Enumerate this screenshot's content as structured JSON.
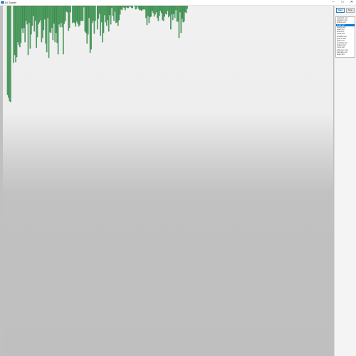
{
  "window": {
    "title": "ID Sorter",
    "minimize_glyph": "–",
    "maximize_glyph": "□",
    "close_glyph": "✕"
  },
  "side_panel": {
    "left_button_label": "Start",
    "right_button_label": "Stop",
    "list_items": [
      "selection sort",
      "insertion sort",
      "bubble sort",
      "quick sort",
      "merge sort",
      "heap sort",
      "shell sort",
      "comb sort",
      "cocktail sort",
      "gnome sort",
      "radix sort",
      "counting sort",
      "bucket sort",
      "cycle sort",
      "odd-even sort",
      "pancake sort",
      "bogo sort"
    ],
    "selected_index": 3
  },
  "chart_data": {
    "type": "bar",
    "orientation": "downward",
    "bar_color": "#5cb56e",
    "values": [
      30,
      26,
      21,
      20,
      217,
      227,
      75,
      86,
      76,
      83,
      104,
      100,
      97,
      103,
      123,
      117,
      124,
      104,
      134,
      129,
      86,
      131,
      95,
      115,
      127,
      141,
      119,
      134,
      96,
      111,
      129,
      132,
      135,
      104,
      110,
      121,
      136,
      102,
      90,
      138,
      82,
      118,
      117,
      124,
      107,
      130,
      104,
      117,
      103,
      87,
      129,
      125,
      131,
      125,
      87,
      130,
      134,
      147,
      146,
      120,
      124,
      146,
      155,
      131,
      132,
      131,
      126,
      133,
      130,
      126,
      128,
      134,
      134,
      134,
      153,
      119,
      117,
      102,
      115,
      138,
      89,
      94,
      131,
      134,
      116,
      134,
      157,
      122,
      137,
      144,
      113,
      132,
      104,
      117,
      142,
      132,
      127,
      135,
      119,
      142,
      129,
      152,
      141,
      134,
      147,
      131,
      132,
      127,
      135,
      143,
      150,
      149,
      153,
      152,
      149,
      153,
      152,
      152,
      154,
      154,
      152,
      152,
      155,
      154,
      150,
      151,
      154,
      151,
      149,
      149,
      148,
      150,
      150,
      150,
      138,
      128,
      141,
      131,
      139,
      140,
      148,
      145,
      140,
      143,
      146,
      138,
      134,
      141,
      148,
      145,
      135,
      134,
      140,
      144,
      143,
      148,
      139,
      141,
      122,
      143,
      135,
      144,
      138,
      149,
      133,
      133,
      110,
      146,
      117,
      137,
      132,
      133,
      146,
      145,
      151
    ]
  }
}
